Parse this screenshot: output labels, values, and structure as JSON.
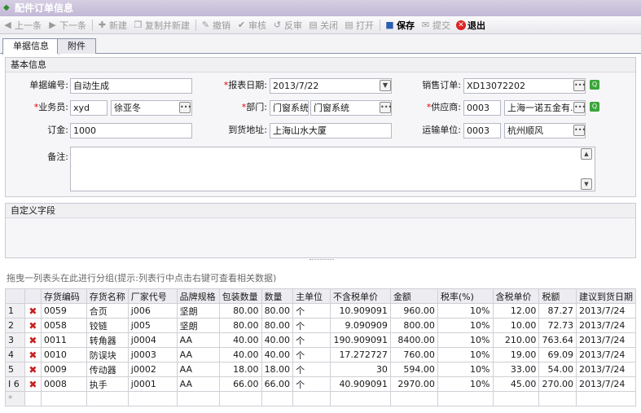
{
  "window": {
    "title": "配件订单信息"
  },
  "toolbar": {
    "items": [
      {
        "label": "上一条",
        "icon": "prev-icon",
        "enabled": false
      },
      {
        "label": "下一条",
        "icon": "next-icon",
        "enabled": false
      },
      {
        "label": "新建",
        "icon": "new-icon",
        "enabled": false
      },
      {
        "label": "复制并新建",
        "icon": "copy-new-icon",
        "enabled": false
      },
      {
        "label": "撤销",
        "icon": "undo-icon",
        "enabled": false
      },
      {
        "label": "审核",
        "icon": "audit-icon",
        "enabled": false
      },
      {
        "label": "反审",
        "icon": "unaudit-icon",
        "enabled": false
      },
      {
        "label": "关闭",
        "icon": "close-doc-icon",
        "enabled": false
      },
      {
        "label": "打开",
        "icon": "open-doc-icon",
        "enabled": false
      },
      {
        "label": "保存",
        "icon": "save-icon",
        "enabled": true
      },
      {
        "label": "提交",
        "icon": "submit-icon",
        "enabled": false
      },
      {
        "label": "退出",
        "icon": "exit-icon",
        "enabled": true
      }
    ]
  },
  "tabs": [
    {
      "label": "单据信息",
      "active": true
    },
    {
      "label": "附件",
      "active": false
    }
  ],
  "basic_info": {
    "header": "基本信息",
    "doc_no_label": "单据编号:",
    "doc_no_value": "自动生成",
    "report_date_label": "报表日期:",
    "report_date_value": "2013/7/22",
    "sales_order_label": "销售订单:",
    "sales_order_value": "XD13072202",
    "salesman_label": "业务员:",
    "salesman_code": "xyd",
    "salesman_name": "徐亚冬",
    "dept_label": "部门:",
    "dept_code": "门窗系统",
    "dept_name": "门窗系统",
    "supplier_label": "供应商:",
    "supplier_code": "0003",
    "supplier_name": "上海一诺五金有...",
    "deposit_label": "订金:",
    "deposit_value": "1000",
    "delivery_addr_label": "到货地址:",
    "delivery_addr_value": "上海山水大厦",
    "carrier_label": "运输单位:",
    "carrier_code": "0003",
    "carrier_name": "杭州顺风",
    "remark_label": "备注:",
    "remark_value": ""
  },
  "custom_fields": {
    "header": "自定义字段"
  },
  "grid": {
    "group_hint": "拖曳一列表头在此进行分组(提示:列表行中点击右键可查看相关数据)",
    "columns": [
      "存货编码",
      "存货名称",
      "厂家代号",
      "品牌规格",
      "包装数量",
      "数量",
      "主单位",
      "不含税单价",
      "金额",
      "税率(%)",
      "含税单价",
      "税额",
      "建议到货日期"
    ],
    "rows": [
      {
        "no": "1",
        "code": "0059",
        "name": "合页",
        "maker": "j006",
        "brand": "坚朗",
        "pack": "80.00",
        "qty": "80.00",
        "unit": "个",
        "price": "10.909091",
        "amount": "960.00",
        "rate": "10%",
        "tax_price": "12.00",
        "tax": "87.27",
        "date": "2013/7/24"
      },
      {
        "no": "2",
        "code": "0058",
        "name": "铰链",
        "maker": "j005",
        "brand": "坚朗",
        "pack": "80.00",
        "qty": "80.00",
        "unit": "个",
        "price": "9.090909",
        "amount": "800.00",
        "rate": "10%",
        "tax_price": "10.00",
        "tax": "72.73",
        "date": "2013/7/24"
      },
      {
        "no": "3",
        "code": "0011",
        "name": "转角器",
        "maker": "j0004",
        "brand": "AA",
        "pack": "40.00",
        "qty": "40.00",
        "unit": "个",
        "price": "190.909091",
        "amount": "8400.00",
        "rate": "10%",
        "tax_price": "210.00",
        "tax": "763.64",
        "date": "2013/7/24"
      },
      {
        "no": "4",
        "code": "0010",
        "name": "防误块",
        "maker": "j0003",
        "brand": "AA",
        "pack": "40.00",
        "qty": "40.00",
        "unit": "个",
        "price": "17.272727",
        "amount": "760.00",
        "rate": "10%",
        "tax_price": "19.00",
        "tax": "69.09",
        "date": "2013/7/24"
      },
      {
        "no": "5",
        "code": "0009",
        "name": "传动器",
        "maker": "j0002",
        "brand": "AA",
        "pack": "18.00",
        "qty": "18.00",
        "unit": "个",
        "price": "30",
        "amount": "594.00",
        "rate": "10%",
        "tax_price": "33.00",
        "tax": "54.00",
        "date": "2013/7/24"
      },
      {
        "no": "I 6",
        "code": "0008",
        "name": "执手",
        "maker": "j0001",
        "brand": "AA",
        "pack": "66.00",
        "qty": "66.00",
        "unit": "个",
        "price": "40.909091",
        "amount": "2970.00",
        "rate": "10%",
        "tax_price": "45.00",
        "tax": "270.00",
        "date": "2013/7/24"
      }
    ],
    "new_row_marker": "*"
  }
}
